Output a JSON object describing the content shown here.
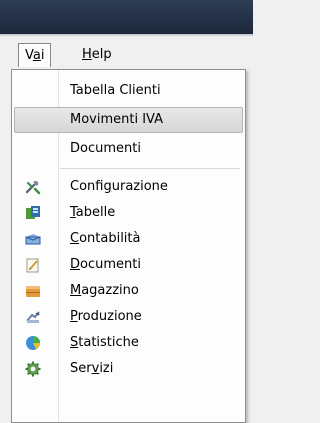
{
  "menubar": {
    "items": [
      {
        "pre": "V",
        "ul": "a",
        "post": "i"
      },
      {
        "pre": "",
        "ul": "H",
        "post": "elp"
      }
    ]
  },
  "dropdown": {
    "quick": [
      {
        "label": "Tabella Clienti"
      },
      {
        "label": "Movimenti IVA",
        "highlighted": true
      },
      {
        "label": "Documenti"
      }
    ],
    "modules": [
      {
        "pre": "Confi",
        "ul": "g",
        "post": "urazione",
        "icon": "tools-icon"
      },
      {
        "pre": "",
        "ul": "T",
        "post": "abelle",
        "icon": "tables-icon"
      },
      {
        "pre": "",
        "ul": "C",
        "post": "ontabilità",
        "icon": "accounting-icon"
      },
      {
        "pre": "",
        "ul": "D",
        "post": "ocumenti",
        "icon": "documents-icon"
      },
      {
        "pre": "",
        "ul": "M",
        "post": "agazzino",
        "icon": "warehouse-icon"
      },
      {
        "pre": "",
        "ul": "P",
        "post": "roduzione",
        "icon": "production-icon"
      },
      {
        "pre": "",
        "ul": "S",
        "post": "tatistiche",
        "icon": "statistics-icon"
      },
      {
        "pre": "Ser",
        "ul": "v",
        "post": "izi",
        "icon": "services-icon"
      }
    ]
  },
  "colors": {
    "highlight": "#d9d9d9",
    "menu_bg": "#fdfdfd",
    "titlebar": "#233046"
  }
}
